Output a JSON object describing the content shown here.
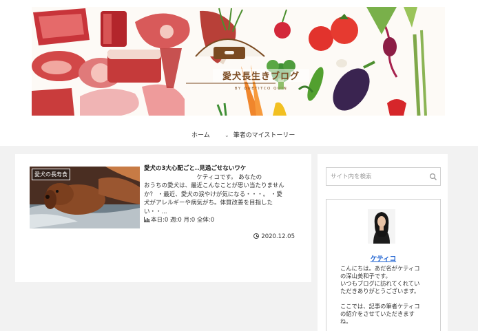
{
  "header": {
    "logo_title": "愛犬長生きブログ",
    "logo_subtitle": "BY QUETITCO QUIN"
  },
  "nav": {
    "items": [
      {
        "label": "ホーム"
      },
      {
        "label": "筆者のマイストーリー",
        "has_dropdown": true
      }
    ]
  },
  "post": {
    "category": "愛犬の長寿食",
    "title": "愛犬の3大心配ごと..見過ごせないワケ",
    "excerpt": "　　　　　　　　　ケティコです。 あなたの\nおうちの愛犬は、最近こんなことが思い当たりません\nか？ ・最近、愛犬の涙やけが気になる・・・。 ・愛\n犬がアレルギーや病気がち。体質改善を目指した\nい・・...",
    "stats": "本日:0 週:0 月:0 全体:0",
    "date": "2020.12.05"
  },
  "sidebar": {
    "search_placeholder": "サイト内を検索",
    "profile_name": "ケティコ",
    "profile_text": "こんにちは。あだ名がケティコ\nの深山美和子です。\nいつもブログに訪れてくれてい\nただきありがとうございます。\n\nここでは、記事の筆者ケティコ\nの紹介をさせていただきます\nね。"
  },
  "colors": {
    "link": "#1a5fd0",
    "logo_brown": "#7a4a21",
    "page_bg": "#f2f2f2"
  },
  "icons": [
    "search-icon",
    "chevron-down-icon",
    "bar-chart-icon",
    "clock-icon"
  ]
}
